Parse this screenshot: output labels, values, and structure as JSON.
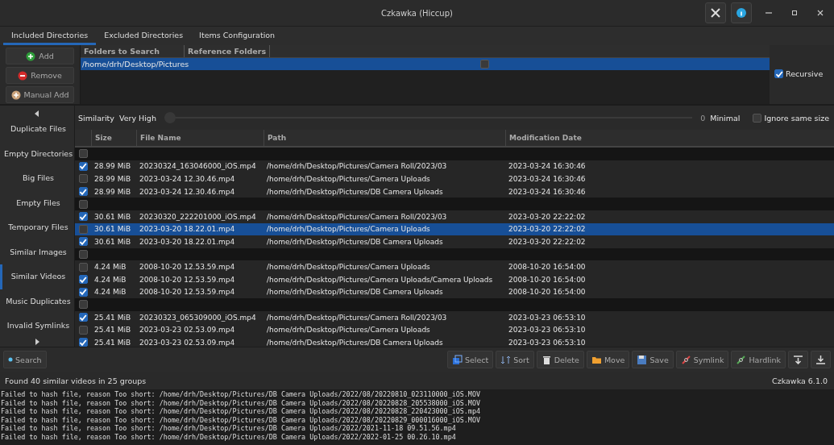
{
  "window": {
    "title": "Czkawka (Hiccup)"
  },
  "tabs": [
    {
      "label": "Included Directories",
      "selected": true
    },
    {
      "label": "Excluded Directories",
      "selected": false
    },
    {
      "label": "Items Configuration",
      "selected": false
    }
  ],
  "directories": {
    "buttons": [
      {
        "label": "Add",
        "kind": "add"
      },
      {
        "label": "Remove",
        "kind": "remove"
      },
      {
        "label": "Manual Add",
        "kind": "manual"
      }
    ],
    "columns": [
      "Folders to Search",
      "Reference Folders"
    ],
    "rows": [
      {
        "path": "/home/drh/Desktop/Pictures",
        "reference": false,
        "selected": true
      }
    ],
    "recursive": {
      "label": "Recursive",
      "checked": true
    }
  },
  "sidebar": {
    "items": [
      {
        "label": "Duplicate Files",
        "selected": false
      },
      {
        "label": "Empty Directories",
        "selected": false
      },
      {
        "label": "Big Files",
        "selected": false
      },
      {
        "label": "Empty Files",
        "selected": false
      },
      {
        "label": "Temporary Files",
        "selected": false
      },
      {
        "label": "Similar Images",
        "selected": false
      },
      {
        "label": "Similar Videos",
        "selected": true
      },
      {
        "label": "Music Duplicates",
        "selected": false
      },
      {
        "label": "Invalid Symlinks",
        "selected": false
      }
    ]
  },
  "similarity": {
    "label": "Similarity",
    "value": "Very High",
    "level": 0,
    "reading": "0",
    "end_label": "Minimal",
    "ignore_same_size": {
      "label": "Ignore same size",
      "checked": false
    }
  },
  "table": {
    "columns": [
      "Size",
      "File Name",
      "Path",
      "Modification Date"
    ],
    "rows": [
      {
        "kind": "group",
        "checked": false
      },
      {
        "kind": "file",
        "checked": true,
        "selected": false,
        "size": "28.99 MiB",
        "name": "20230324_163046000_iOS.mp4",
        "path": "/home/drh/Desktop/Pictures/Camera Roll/2023/03",
        "date": "2023-03-24 16:30:46"
      },
      {
        "kind": "file",
        "checked": false,
        "selected": false,
        "size": "28.99 MiB",
        "name": "2023-03-24 12.30.46.mp4",
        "path": "/home/drh/Desktop/Pictures/Camera Uploads",
        "date": "2023-03-24 16:30:46"
      },
      {
        "kind": "file",
        "checked": true,
        "selected": false,
        "size": "28.99 MiB",
        "name": "2023-03-24 12.30.46.mp4",
        "path": "/home/drh/Desktop/Pictures/DB Camera Uploads",
        "date": "2023-03-24 16:30:46"
      },
      {
        "kind": "group",
        "checked": false
      },
      {
        "kind": "file",
        "checked": true,
        "selected": false,
        "size": "30.61 MiB",
        "name": "20230320_222201000_iOS.mp4",
        "path": "/home/drh/Desktop/Pictures/Camera Roll/2023/03",
        "date": "2023-03-20 22:22:02"
      },
      {
        "kind": "file",
        "checked": false,
        "selected": true,
        "size": "30.61 MiB",
        "name": "2023-03-20 18.22.01.mp4",
        "path": "/home/drh/Desktop/Pictures/Camera Uploads",
        "date": "2023-03-20 22:22:02"
      },
      {
        "kind": "file",
        "checked": true,
        "selected": false,
        "size": "30.61 MiB",
        "name": "2023-03-20 18.22.01.mp4",
        "path": "/home/drh/Desktop/Pictures/DB Camera Uploads",
        "date": "2023-03-20 22:22:02"
      },
      {
        "kind": "group",
        "checked": false
      },
      {
        "kind": "file",
        "checked": false,
        "selected": false,
        "size": "4.24 MiB",
        "name": "2008-10-20 12.53.59.mp4",
        "path": "/home/drh/Desktop/Pictures/Camera Uploads",
        "date": "2008-10-20 16:54:00"
      },
      {
        "kind": "file",
        "checked": true,
        "selected": false,
        "size": "4.24 MiB",
        "name": "2008-10-20 12.53.59.mp4",
        "path": "/home/drh/Desktop/Pictures/Camera Uploads/Camera Uploads",
        "date": "2008-10-20 16:54:00"
      },
      {
        "kind": "file",
        "checked": true,
        "selected": false,
        "size": "4.24 MiB",
        "name": "2008-10-20 12.53.59.mp4",
        "path": "/home/drh/Desktop/Pictures/DB Camera Uploads",
        "date": "2008-10-20 16:54:00"
      },
      {
        "kind": "group",
        "checked": false
      },
      {
        "kind": "file",
        "checked": true,
        "selected": false,
        "size": "25.41 MiB",
        "name": "20230323_065309000_iOS.mp4",
        "path": "/home/drh/Desktop/Pictures/Camera Roll/2023/03",
        "date": "2023-03-23 06:53:10"
      },
      {
        "kind": "file",
        "checked": false,
        "selected": false,
        "size": "25.41 MiB",
        "name": "2023-03-23 02.53.09.mp4",
        "path": "/home/drh/Desktop/Pictures/Camera Uploads",
        "date": "2023-03-23 06:53:10"
      },
      {
        "kind": "file",
        "checked": true,
        "selected": false,
        "size": "25.41 MiB",
        "name": "2023-03-23 02.53.09.mp4",
        "path": "/home/drh/Desktop/Pictures/DB Camera Uploads",
        "date": "2023-03-23 06:53:10"
      }
    ]
  },
  "actions": {
    "search": {
      "label": "Search"
    },
    "buttons": [
      {
        "label": "Select",
        "kind": "select"
      },
      {
        "label": "Sort",
        "kind": "sort"
      },
      {
        "label": "Delete",
        "kind": "delete"
      },
      {
        "label": "Move",
        "kind": "move"
      },
      {
        "label": "Save",
        "kind": "save"
      },
      {
        "label": "Symlink",
        "kind": "symlink"
      },
      {
        "label": "Hardlink",
        "kind": "hardlink"
      },
      {
        "kind": "down"
      },
      {
        "kind": "bottom"
      }
    ]
  },
  "status_bar": {
    "message": "Found 40 similar videos in 25 groups",
    "version": "Czkawka 6.1.0"
  },
  "log": [
    "Failed to hash file, reason Too short: /home/drh/Desktop/Pictures/DB Camera Uploads/2022/08/20220810_023110000_iOS.MOV",
    "Failed to hash file, reason Too short: /home/drh/Desktop/Pictures/DB Camera Uploads/2022/08/20220828_205538000_iOS.MOV",
    "Failed to hash file, reason Too short: /home/drh/Desktop/Pictures/DB Camera Uploads/2022/08/20220828_220423000_iOS.mp4",
    "Failed to hash file, reason Too short: /home/drh/Desktop/Pictures/DB Camera Uploads/2022/08/20220829_000016000_iOS.MOV",
    "Failed to hash file, reason Too short: /home/drh/Desktop/Pictures/DB Camera Uploads/2022/2021-11-18 09.51.56.mp4",
    "Failed to hash file, reason Too short: /home/drh/Desktop/Pictures/DB Camera Uploads/2022/2022-01-25 00.26.10.mp4"
  ]
}
